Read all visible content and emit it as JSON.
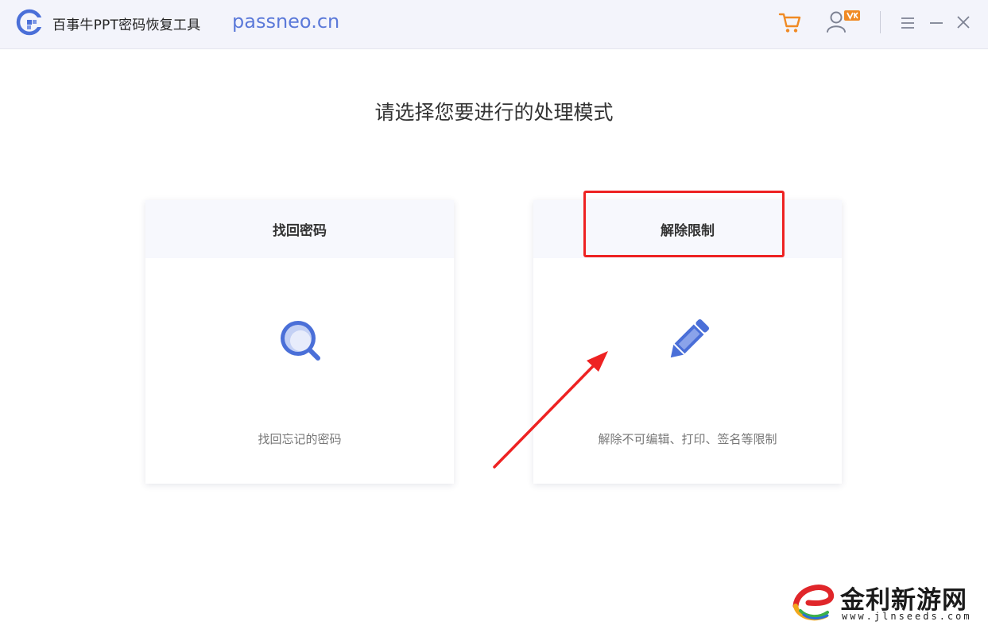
{
  "titlebar": {
    "app_name": "百事牛PPT密码恢复工具",
    "site": "passneo.cn",
    "icons": [
      "cart-icon",
      "user-vip-icon",
      "menu-icon",
      "minimize-icon",
      "close-icon"
    ],
    "accent_color": "#f08a24",
    "brand_color": "#5b79d9"
  },
  "main": {
    "heading": "请选择您要进行的处理模式",
    "cards": [
      {
        "title": "找回密码",
        "description": "找回忘记的密码",
        "icon": "magnifier-icon"
      },
      {
        "title": "解除限制",
        "description": "解除不可编辑、打印、签名等限制",
        "icon": "pencil-icon"
      }
    ]
  },
  "annotation": {
    "highlight_color": "#ee2222"
  },
  "watermark": {
    "name": "金利新游网",
    "url": "www.jlnseeds.com"
  }
}
